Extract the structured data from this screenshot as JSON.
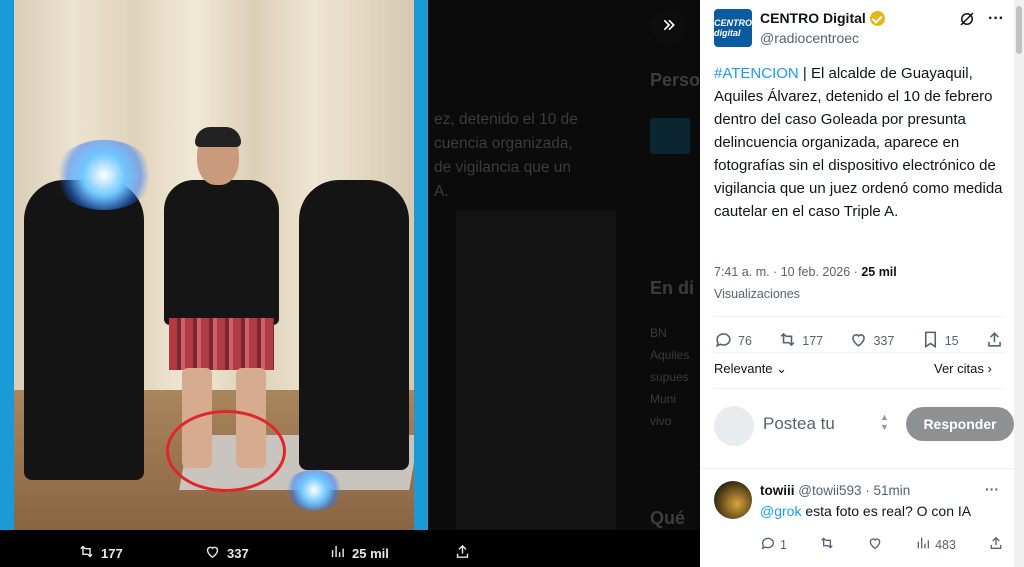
{
  "media": {
    "stats": {
      "retweets": "177",
      "likes": "337",
      "views": "25 mil"
    }
  },
  "background": {
    "snippet_lines": [
      "ez, detenido el 10 de",
      "cuencia organizada,",
      "de vigilancia que un",
      "A."
    ],
    "side_heading_1": "Perso",
    "side_heading_2": "En di",
    "side_heading_3": "Qué c",
    "side_line_1": "BN",
    "side_line_2": "Aquiles",
    "side_line_3": "supues",
    "side_line_4": "Muni",
    "side_line_5": "vivo"
  },
  "tweet": {
    "account_name": "CENTRO Digital",
    "handle": "@radiocentroec",
    "avatar_label": "CENTRO digital",
    "hashtag": "#ATENCION",
    "body": " | El alcalde de Guayaquil, Aquiles Álvarez, detenido el 10 de febrero dentro del caso Goleada por presunta delincuencia organizada, aparece en fotografías sin el dispositivo electrónico de vigilancia que un juez ordenó como medida cautelar en el caso Triple A.",
    "timestamp": "7:41 a. m. · 10 feb. 2026 · ",
    "views_count": "25 mil",
    "views_label": "Visualizaciones",
    "replies": "76",
    "retweets": "177",
    "likes": "337",
    "bookmarks": "15"
  },
  "sort": {
    "relevant_label": "Relevante",
    "quotes_label": "Ver citas"
  },
  "reply_box": {
    "placeholder": "Postea tu",
    "button_label": "Responder"
  },
  "comment": {
    "name": "towiii",
    "handle": "@towii593 · 51min",
    "mention": "@grok",
    "text": " esta foto es real? O con IA",
    "replies": "1",
    "views": "483"
  },
  "colors": {
    "accent": "#1d9bf0",
    "badge": "#e2b719",
    "annotation": "#e0262a"
  }
}
